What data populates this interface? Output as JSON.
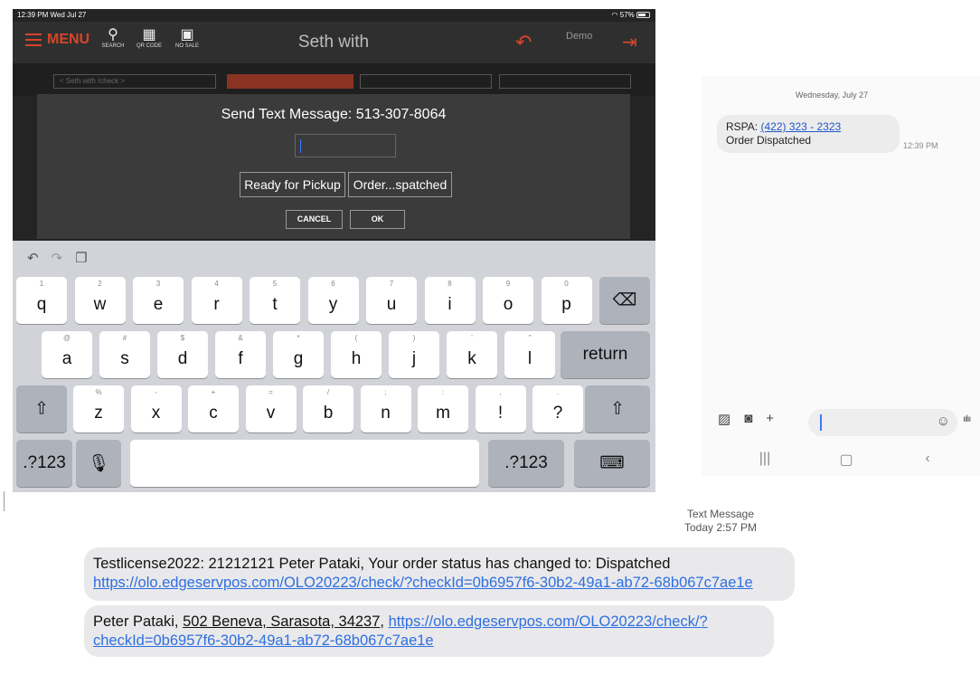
{
  "ipad": {
    "status": {
      "left": "12:39 PM  Wed Jul 27",
      "right": "57%"
    },
    "nav": {
      "menu_label": "MENU",
      "search_label": "SEARCH",
      "qr_label": "QR CODE",
      "nosale_label": "NO SALE",
      "title": "Seth with",
      "demo_label": "Demo"
    },
    "bg_tab_label": "< Seth with  /check >",
    "dialog": {
      "title": "Send Text Message: 513-307-8064",
      "input_value": "",
      "quick_ready": "Ready for Pickup",
      "quick_dispatched": "Order...spatched",
      "cancel_label": "CANCEL",
      "ok_label": "OK"
    },
    "keyboard": {
      "row1": [
        {
          "k": "q",
          "s": "1"
        },
        {
          "k": "w",
          "s": "2"
        },
        {
          "k": "e",
          "s": "3"
        },
        {
          "k": "r",
          "s": "4"
        },
        {
          "k": "t",
          "s": "5"
        },
        {
          "k": "y",
          "s": "6"
        },
        {
          "k": "u",
          "s": "7"
        },
        {
          "k": "i",
          "s": "8"
        },
        {
          "k": "o",
          "s": "9"
        },
        {
          "k": "p",
          "s": "0"
        }
      ],
      "row2": [
        {
          "k": "a",
          "s": "@"
        },
        {
          "k": "s",
          "s": "#"
        },
        {
          "k": "d",
          "s": "$"
        },
        {
          "k": "f",
          "s": "&"
        },
        {
          "k": "g",
          "s": "*"
        },
        {
          "k": "h",
          "s": "("
        },
        {
          "k": "j",
          "s": ")"
        },
        {
          "k": "k",
          "s": "'"
        },
        {
          "k": "l",
          "s": "\""
        }
      ],
      "row3": [
        {
          "k": "z",
          "s": "%"
        },
        {
          "k": "x",
          "s": "-"
        },
        {
          "k": "c",
          "s": "+"
        },
        {
          "k": "v",
          "s": "="
        },
        {
          "k": "b",
          "s": "/"
        },
        {
          "k": "n",
          "s": ";"
        },
        {
          "k": "m",
          "s": ":"
        },
        {
          "k": "!",
          "s": ","
        },
        {
          "k": "?",
          "s": "."
        }
      ],
      "return_label": "return",
      "numbers_label": ".?123"
    }
  },
  "android": {
    "date_header": "Wednesday, July 27",
    "message": {
      "sender_prefix": "RSPA: ",
      "phone_link": "(422) 323 - 2323",
      "body": "Order Dispatched",
      "time": "12:39 PM"
    }
  },
  "imessage": {
    "label_line1": "Text Message",
    "label_line2": "Today 2:57 PM",
    "msg1_text": "Testlicense2022: 21212121   Peter Pataki, Your order status has changed to: Dispatched ",
    "msg1_link": "https://olo.edgeservpos.com/OLO20223/check/?checkId=0b6957f6-30b2-49a1-ab72-68b067c7ae1e",
    "msg2_prefix": "Peter Pataki, ",
    "msg2_address": "502 Beneva, Sarasota, 34237",
    "msg2_sep": ", ",
    "msg2_link": "https://olo.edgeservpos.com/OLO20223/check/?checkId=0b6957f6-30b2-49a1-ab72-68b067c7ae1e"
  }
}
